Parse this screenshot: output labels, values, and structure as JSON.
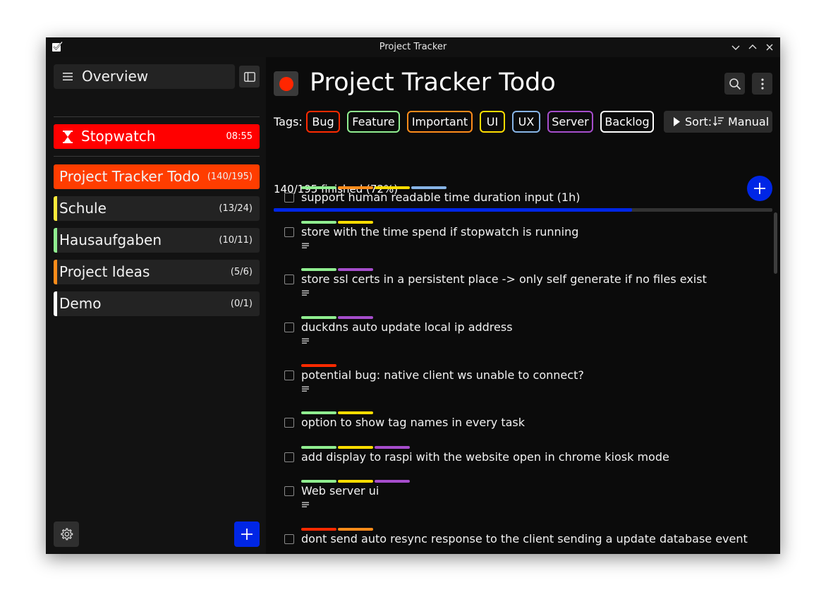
{
  "window": {
    "title": "Project Tracker"
  },
  "sidebar": {
    "overview_label": "Overview",
    "stopwatch": {
      "label": "Stopwatch",
      "time": "08:55"
    },
    "projects": [
      {
        "name": "Project Tracker Todo",
        "count": "(140/195)",
        "color": "#ff3d00",
        "active": true
      },
      {
        "name": "Schule",
        "count": "(13/24)",
        "color": "#ffeb3b",
        "active": false
      },
      {
        "name": "Hausaufgaben",
        "count": "(10/11)",
        "color": "#90ee90",
        "active": false
      },
      {
        "name": "Project Ideas",
        "count": "(5/6)",
        "color": "#ff8c1a",
        "active": false
      },
      {
        "name": "Demo",
        "count": "(0/1)",
        "color": "#ffffff",
        "active": false
      }
    ]
  },
  "header": {
    "title": "Project Tracker Todo",
    "color": "#ff2600"
  },
  "tags_label": "Tags:",
  "tags": [
    {
      "name": "Bug",
      "color": "#ff2a00"
    },
    {
      "name": "Feature",
      "color": "#90ee90"
    },
    {
      "name": "Important",
      "color": "#ff8c1a"
    },
    {
      "name": "UI",
      "color": "#ffdd00"
    },
    {
      "name": "UX",
      "color": "#87b4e6"
    },
    {
      "name": "Server",
      "color": "#a64dcc"
    },
    {
      "name": "Backlog",
      "color": "#ffffff"
    }
  ],
  "sort": {
    "prefix": "Sort:",
    "value": "Manual"
  },
  "progress": {
    "text": "140/195 finished (72%)",
    "fraction": 0.718
  },
  "tasks": [
    {
      "text": "support human readable time duration input (1h)",
      "tags": [
        "#90ee90",
        "#ff8c1a",
        "#ffdd00",
        "#87b4e6"
      ],
      "has_note": false
    },
    {
      "text": "store with the time spend if stopwatch is running",
      "tags": [
        "#90ee90",
        "#ffdd00"
      ],
      "has_note": true
    },
    {
      "text": "store ssl certs in a persistent place -> only self generate if no files exist",
      "tags": [
        "#90ee90",
        "#a64dcc"
      ],
      "has_note": true
    },
    {
      "text": "duckdns auto update local ip address",
      "tags": [
        "#90ee90",
        "#a64dcc"
      ],
      "has_note": true
    },
    {
      "text": "potential bug: native client ws unable to connect?",
      "tags": [
        "#ff2a00"
      ],
      "has_note": true
    },
    {
      "text": "option to show tag names in every task",
      "tags": [
        "#90ee90",
        "#ffdd00"
      ],
      "has_note": false
    },
    {
      "text": "add display to raspi with the website open in chrome kiosk mode",
      "tags": [
        "#90ee90",
        "#ffdd00",
        "#a64dcc"
      ],
      "has_note": false
    },
    {
      "text": "Web server ui",
      "tags": [
        "#90ee90",
        "#ffdd00",
        "#a64dcc"
      ],
      "has_note": true
    },
    {
      "text": "dont send auto resync response to the client sending a update database event",
      "tags": [
        "#ff2a00",
        "#ff8c1a"
      ],
      "has_note": false
    }
  ]
}
